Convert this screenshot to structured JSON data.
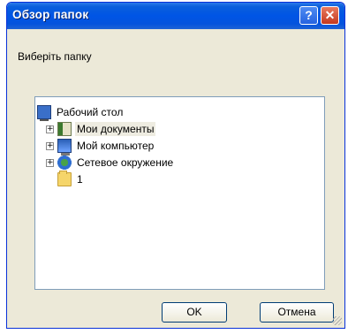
{
  "window": {
    "title": "Обзор папок",
    "help_label": "?",
    "close_label": "✕"
  },
  "prompt": "Виберіть папку",
  "tree": {
    "items": [
      {
        "label": "Рабочий стол",
        "icon": "desktop-icon",
        "expandable": false,
        "selected": false
      },
      {
        "label": "Мои документы",
        "icon": "my-documents-icon",
        "expandable": true,
        "selected": true
      },
      {
        "label": "Мой компьютер",
        "icon": "my-computer-icon",
        "expandable": true,
        "selected": false
      },
      {
        "label": "Сетевое окружение",
        "icon": "network-icon",
        "expandable": true,
        "selected": false
      },
      {
        "label": "1",
        "icon": "folder-icon",
        "expandable": false,
        "selected": false
      }
    ]
  },
  "buttons": {
    "ok": "OK",
    "cancel": "Отмена"
  }
}
